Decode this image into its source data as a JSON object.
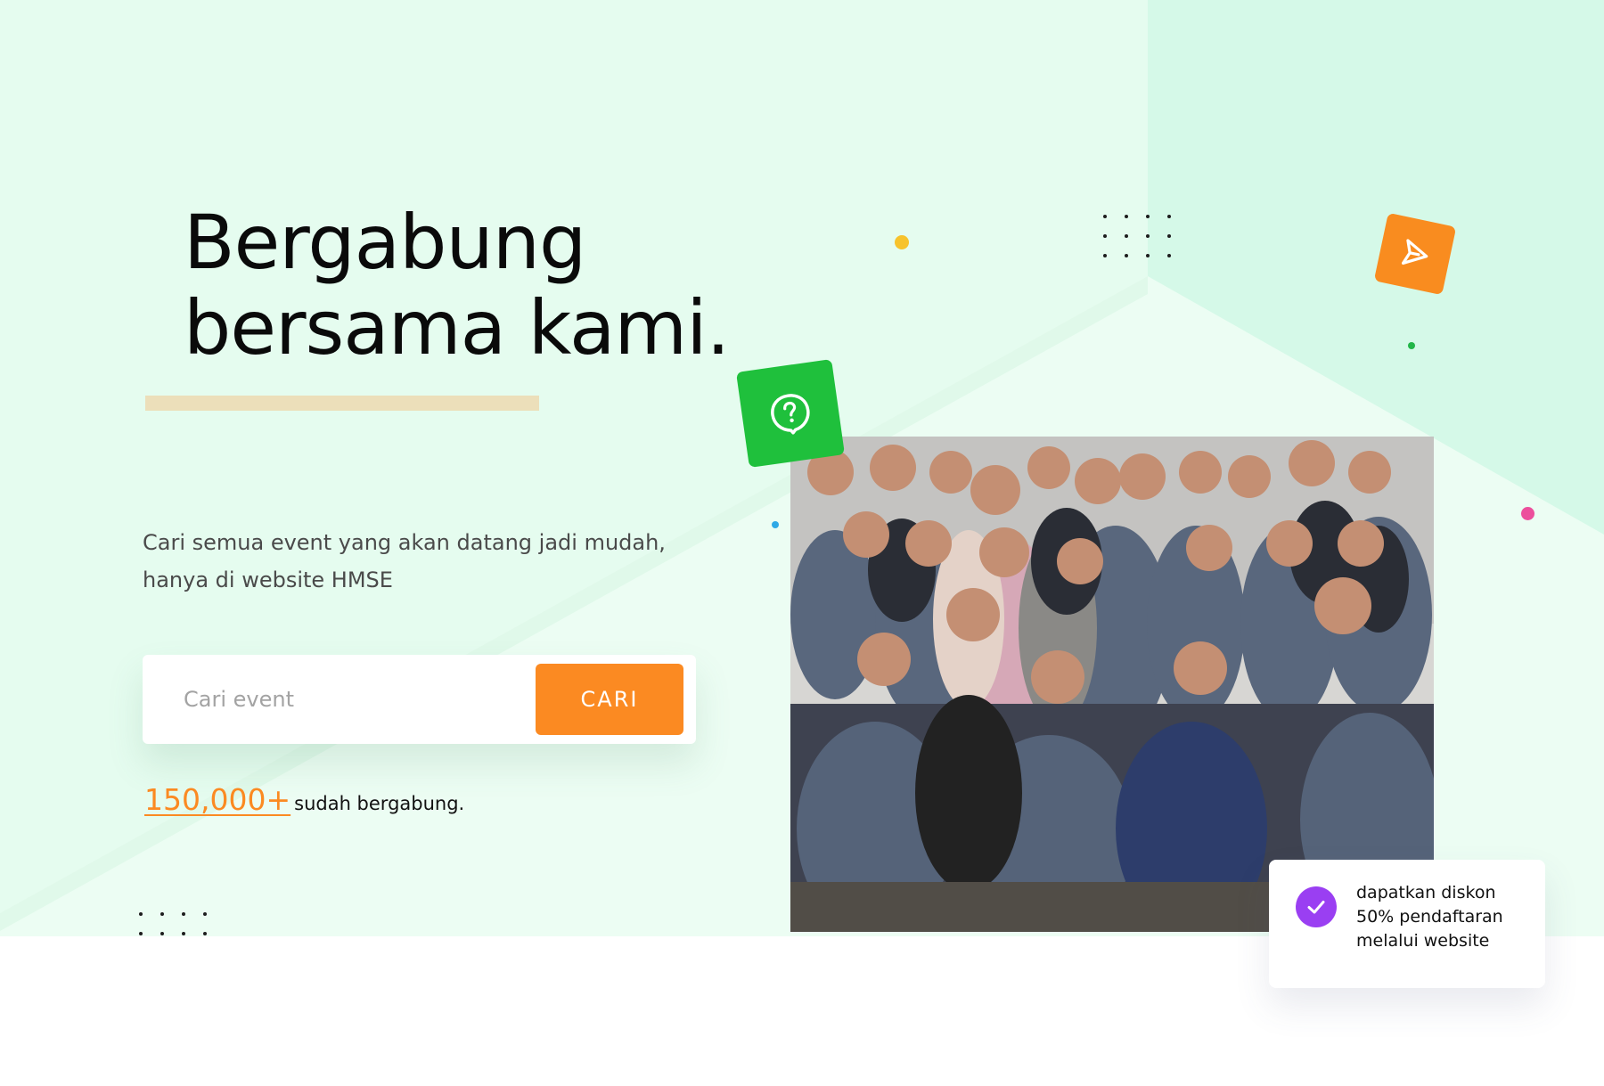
{
  "hero": {
    "title_line1": "Bergabung",
    "title_line2": "bersama kami.",
    "subtitle_line1": "Cari semua event yang akan datang jadi mudah,",
    "subtitle_line2": "hanya di website HMSE"
  },
  "search": {
    "placeholder": "Cari event",
    "button_label": "CARI"
  },
  "stats": {
    "count": "150,000+",
    "label": "sudah bergabung."
  },
  "promo": {
    "line1": "dapatkan diskon",
    "line2": "50% pendaftaran",
    "line3": "melalui website"
  },
  "icons": {
    "question_tile": "question-bubble-icon",
    "send_tile": "paper-plane-icon",
    "promo_check": "check-icon"
  },
  "colors": {
    "background": "#e5fcef",
    "accent_orange": "#fb8a22",
    "accent_green": "#1fc03c",
    "accent_purple": "#9a3ff2",
    "accent_bar": "#ecdfba",
    "confetti_yellow": "#f7c32c",
    "confetti_pink": "#ec4f9c",
    "confetti_blue": "#2fa9e6"
  }
}
